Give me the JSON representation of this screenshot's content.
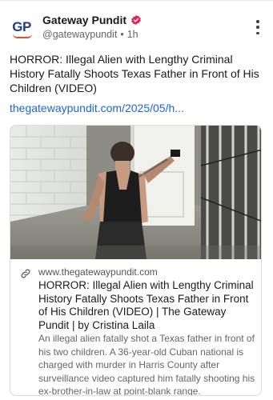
{
  "author": {
    "display_name": "Gateway Pundit",
    "handle": "@gatewaypundit",
    "separator": "•",
    "time": "1h",
    "avatar_text": "GP",
    "verified_color": "#e0245e",
    "brand_color": "#1f3d8a"
  },
  "post": {
    "text": "HORROR: Illegal Alien with Lengthy Criminal History Fatally Shoots Texas Father in Front of His Children (VIDEO)",
    "link": "thegatewaypundit.com/2025/05/h..."
  },
  "link_card": {
    "icon": "link-icon",
    "domain": "www.thegatewaypundit.com",
    "title": "HORROR: Illegal Alien with Lengthy Criminal History Fatally Shoots Texas Father in Front of His Children (VIDEO) | The Gateway Pundit | by Cristina Laila",
    "description": "An illegal alien fatally shot a Texas father in front of his two children. A 36-year-old Cuban national is charged with murder in Harris County after surveillance video captured him fatally shooting his ex-brother-in-law at point-blank range."
  },
  "icons": {
    "verified": "verified-badge-icon",
    "more": "more-vertical-icon",
    "link": "link-icon"
  },
  "colors": {
    "link": "#1d64d8",
    "muted": "#666666",
    "text": "#1a1a1a"
  }
}
